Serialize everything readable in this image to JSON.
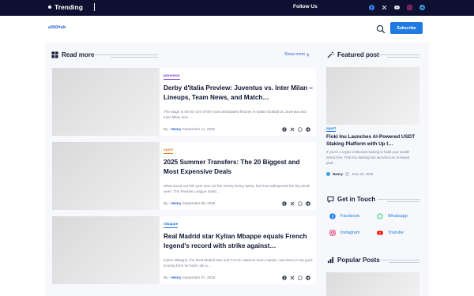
{
  "topbar": {
    "trending_label": "Trending",
    "follow_label": "Follow Us",
    "social": [
      "facebook-icon",
      "x-icon",
      "youtube-icon",
      "instagram-icon",
      "telegram-icon"
    ]
  },
  "header": {
    "logo_text": "a360hub",
    "subscribe_label": "Subscribe"
  },
  "main": {
    "section_title": "Read more",
    "show_more_label": "Show more",
    "articles": [
      {
        "tag": "previews",
        "tag_color": "#7a3fd0",
        "title": "Derby d'Italia Preview: Juventus vs. Inter Milan – Lineups, Team News, and Match…",
        "excerpt": "The stage is set for one of the most anticipated fixtures in Italian football as Juventus and Inter Milan lock …",
        "by": "By -",
        "author": "Henry",
        "date": "September 11, 2025"
      },
      {
        "tag": "sport",
        "tag_color": "#e07a1f",
        "title": "2025 Summer Transfers: The 20 Biggest and Most Expensive Deals",
        "excerpt": "What stood out this year was not the money being spent, but how widespread the big deals were. The Premier League maint…",
        "by": "By -",
        "author": "Henry",
        "date": "September 08, 2025"
      },
      {
        "tag": "mbappe",
        "tag_color": "#1f7be0",
        "title": "Real Madrid star Kylian Mbappe equals French legend's record with strike against…",
        "excerpt": "Kylian Mbappe, the Real Madrid star and French national team captain, has been in top goal-scoring form for both club a…",
        "by": "By -",
        "author": "Henry",
        "date": "September 07, 2025"
      }
    ]
  },
  "sidebar": {
    "featured_title": "Featured post",
    "featured": {
      "tag": "sport",
      "title": "Floki Inu Launches AI-Powered USDT Staking Platform with Up t…",
      "excerpt": "If you're a crypto enthusiast looking to build your wealth stress-free, Floki Inu Staking has launched an AI-based platf…",
      "author": "Nancy",
      "date": "June 20, 2025"
    },
    "get_in_touch_title": "Get in Touch",
    "contacts": [
      {
        "label": "Facebook",
        "icon": "facebook-icon"
      },
      {
        "label": "Whatsapp",
        "icon": "whatsapp-icon"
      },
      {
        "label": "Instagram",
        "icon": "instagram-icon"
      },
      {
        "label": "Youtube",
        "icon": "youtube-icon"
      }
    ],
    "popular_title": "Popular Posts"
  }
}
